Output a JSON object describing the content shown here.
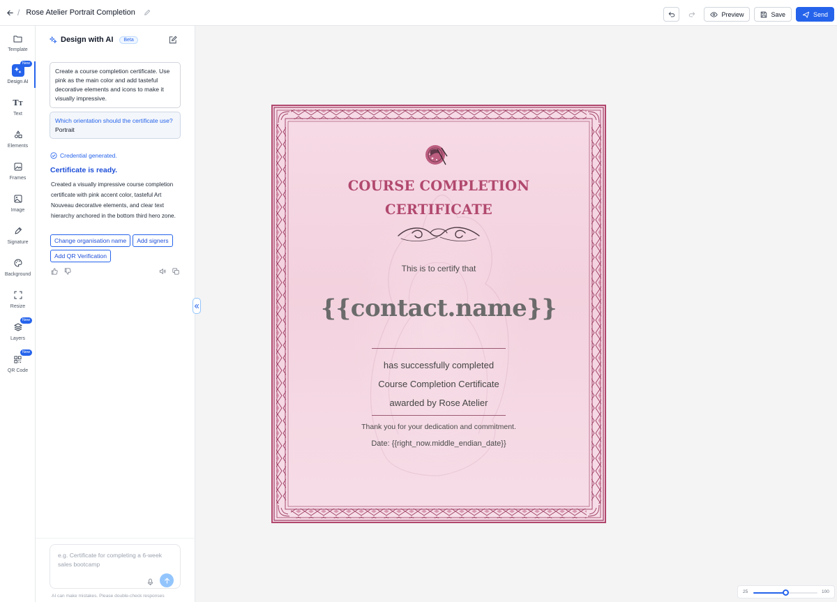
{
  "header": {
    "doc_title": "Rose Atelier Portrait Completion",
    "preview_label": "Preview",
    "save_label": "Save",
    "send_label": "Send"
  },
  "rail": {
    "items": [
      {
        "label": "Template",
        "icon": "folder-icon"
      },
      {
        "label": "Design AI",
        "icon": "sparkles-icon",
        "badge": "New",
        "active": true
      },
      {
        "label": "Text",
        "icon": "text-icon"
      },
      {
        "label": "Elements",
        "icon": "shapes-icon"
      },
      {
        "label": "Frames",
        "icon": "frame-icon"
      },
      {
        "label": "Image",
        "icon": "image-icon"
      },
      {
        "label": "Signature",
        "icon": "pen-icon"
      },
      {
        "label": "Background",
        "icon": "palette-icon"
      },
      {
        "label": "Resize",
        "icon": "resize-icon"
      },
      {
        "label": "Layers",
        "icon": "layers-icon",
        "badge": "New"
      },
      {
        "label": "QR Code",
        "icon": "qr-icon",
        "badge": "New"
      }
    ]
  },
  "ai_panel": {
    "title": "Design with AI",
    "beta": "Beta",
    "user_message": "Create a course completion certificate. Use pink as the main color and add tasteful decorative elements and icons to make it visually impressive.",
    "question": "Which orientation should the certificate use?",
    "answer": "Portrait",
    "status": "Credential generated.",
    "ready": "Certificate is ready.",
    "description": "Created a visually impressive course completion certificate with pink accent color, tasteful Art Nouveau decorative elements, and clear text hierarchy anchored in the bottom third hero zone.",
    "chips": [
      "Change organisation name",
      "Add signers",
      "Add QR Verification"
    ],
    "input_placeholder": "e.g. Certificate for completing a 6-week sales bootcamp",
    "disclaimer": "AI can make mistakes. Please double-check responses"
  },
  "certificate": {
    "title_line1": "COURSE COMPLETION",
    "title_line2": "CERTIFICATE",
    "certify": "This is to certify that",
    "name": "{{contact.name}}",
    "line1": "has successfully completed",
    "line2": "Course Completion Certificate",
    "line3": "awarded by Rose Atelier",
    "thanks": "Thank you for your dedication and commitment.",
    "date": "Date: {{right_now.middle_endian_date}}",
    "accent_color": "#b1486d",
    "background_color": "#f5d8e3"
  },
  "zoom": {
    "min_label": "25",
    "max_label": "100",
    "value_fraction": 0.5
  }
}
